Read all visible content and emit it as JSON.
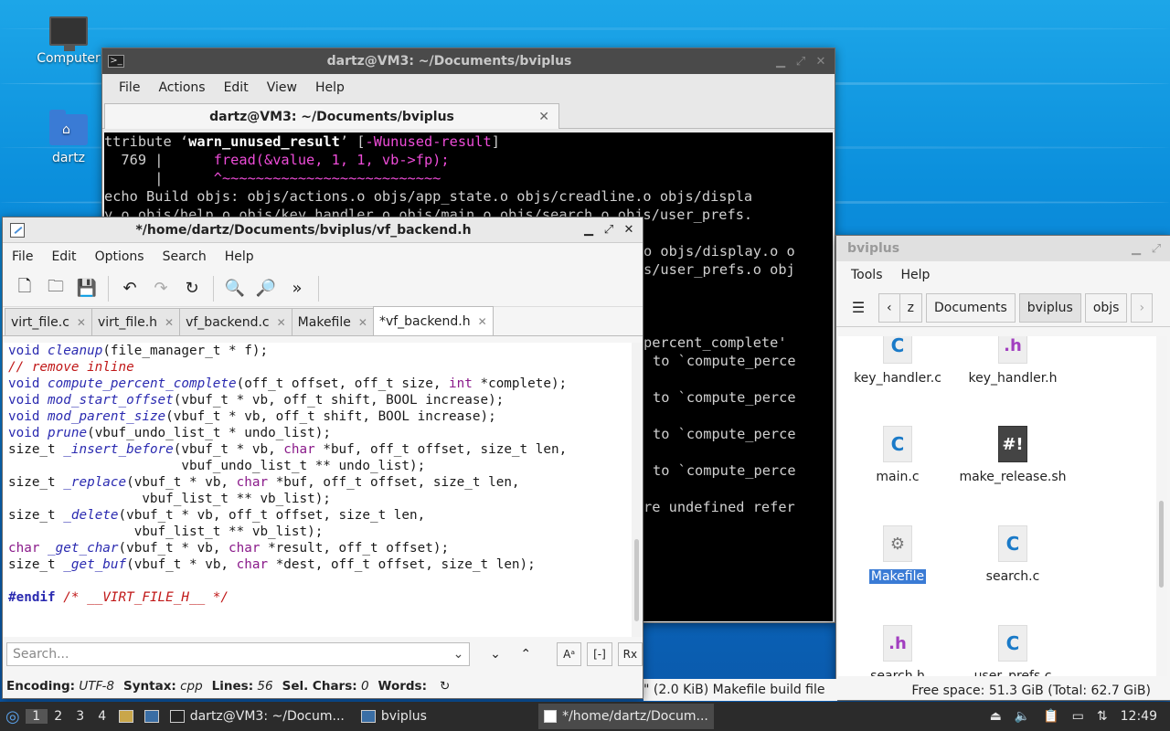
{
  "desktop": {
    "icons": [
      {
        "label": "Computer"
      },
      {
        "label": "dartz"
      }
    ]
  },
  "terminal": {
    "title": "dartz@VM3: ~/Documents/bviplus",
    "menu": [
      "File",
      "Actions",
      "Edit",
      "View",
      "Help"
    ],
    "tab_label": "dartz@VM3: ~/Documents/bviplus",
    "lines": {
      "l1_pre": "ttribute ‘",
      "l1_attr": "warn_unused_result",
      "l1_mid": "’ [",
      "l1_flag": "-Wunused-result",
      "l1_post": "]",
      "l2_num": "  769 |      ",
      "l2_code": "fread(&value, 1, 1, vb->fp);",
      "l3_pre": "      |      ",
      "l3_caret": "^~~~~~~~~~~~~~~~~~~~~~~~~~~",
      "l4": "echo Build objs: objs/actions.o objs/app_state.o objs/creadline.o objs/displa",
      "l5": "y.o objs/help.o objs/key_handler.o objs/main.o objs/search.o objs/user_prefs.",
      "l6": "o objs/display.o o",
      "l7": "s/user_prefs.o obj",
      "l8": "percent_complete'",
      "l9": "to `compute_perce",
      "l10": "to `compute_perce",
      "l11": "to `compute_perce",
      "l12": "to `compute_perce",
      "l13": "re undefined refer"
    }
  },
  "editor": {
    "title": "*/home/dartz/Documents/bviplus/vf_backend.h",
    "menu": [
      "File",
      "Edit",
      "Options",
      "Search",
      "Help"
    ],
    "toolbar_icons": [
      "new-document-icon",
      "open-folder-icon",
      "save-icon",
      "undo-icon",
      "redo-icon",
      "reload-icon",
      "find-icon",
      "find-replace-icon",
      "more-icon"
    ],
    "tabs": [
      "virt_file.c",
      "virt_file.h",
      "vf_backend.c",
      "Makefile",
      "*vf_backend.h"
    ],
    "active_tab": 4,
    "search_placeholder": "Search...",
    "search_opts": {
      "case": "Aᵃ",
      "word": "[-]",
      "regex": "Rx"
    },
    "status": {
      "encoding_label": "Encoding:",
      "encoding": "UTF-8",
      "syntax_label": "Syntax:",
      "syntax": "cpp",
      "lines_label": "Lines:",
      "lines": "56",
      "sel_label": "Sel. Chars:",
      "sel": "0",
      "words_label": "Words:"
    },
    "code": {
      "c1a": "void ",
      "c1f": "cleanup",
      "c1b": "(file_manager_t * f);",
      "c2": "// remove inline",
      "c3a": "void ",
      "c3f": "compute_percent_complete",
      "c3b": "(off_t offset, off_t size, ",
      "c3t": "int",
      "c3c": " *complete);",
      "c4a": "void ",
      "c4f": "mod_start_offset",
      "c4b": "(vbuf_t * vb, off_t shift, BOOL increase);",
      "c5a": "void ",
      "c5f": "mod_parent_size",
      "c5b": "(vbuf_t * vb, off_t shift, BOOL increase);",
      "c6a": "void ",
      "c6f": "prune",
      "c6b": "(vbuf_undo_list_t * undo_list);",
      "c7a": "size_t ",
      "c7f": "_insert_before",
      "c7b": "(vbuf_t * vb, ",
      "c7t": "char",
      "c7c": " *buf, off_t offset, size_t len,",
      "c8": "                      vbuf_undo_list_t ** undo_list);",
      "c9a": "size_t ",
      "c9f": "_replace",
      "c9b": "(vbuf_t * vb, ",
      "c9t": "char",
      "c9c": " *buf, off_t offset, size_t len,",
      "c10": "                 vbuf_list_t ** vb_list);",
      "c11a": "size_t ",
      "c11f": "_delete",
      "c11b": "(vbuf_t * vb, off_t offset, size_t len,",
      "c12": "                vbuf_list_t ** vb_list);",
      "c13t": "char",
      "c13f": " _get_char",
      "c13b": "(vbuf_t * vb, ",
      "c13t2": "char",
      "c13c": " *result, off_t offset);",
      "c14a": "size_t ",
      "c14f": "_get_buf",
      "c14b": "(vbuf_t * vb, ",
      "c14t": "char",
      "c14c": " *dest, off_t offset, size_t len);",
      "c15p": "#endif",
      "c15c": " /* __VIRT_FILE_H__ */"
    }
  },
  "filemanager": {
    "title": "bviplus",
    "menu": [
      "Tools",
      "Help"
    ],
    "path": [
      "z",
      "Documents",
      "bviplus",
      "objs"
    ],
    "files": [
      {
        "name": "key_handler.c",
        "kind": "C"
      },
      {
        "name": "key_handler.h",
        "kind": ".h"
      },
      {
        "name": "main.c",
        "kind": "C"
      },
      {
        "name": "make_release.sh",
        "kind": "#!"
      },
      {
        "name": "Makefile",
        "kind": "⚙"
      },
      {
        "name": "search.c",
        "kind": "C"
      },
      {
        "name": "search.h",
        "kind": ".h"
      },
      {
        "name": "user_prefs.c",
        "kind": "C"
      }
    ],
    "selected_file": "Makefile",
    "status": "Free space: 51.3 GiB (Total: 62.7 GiB)",
    "status_left": "\" (2.0 KiB) Makefile build file"
  },
  "taskbar": {
    "workspaces": [
      "1",
      "2",
      "3",
      "4"
    ],
    "tasks": [
      "dartz@VM3: ~/Docum...",
      "bviplus",
      "*/home/dartz/Docum..."
    ],
    "clock": "12:49"
  }
}
